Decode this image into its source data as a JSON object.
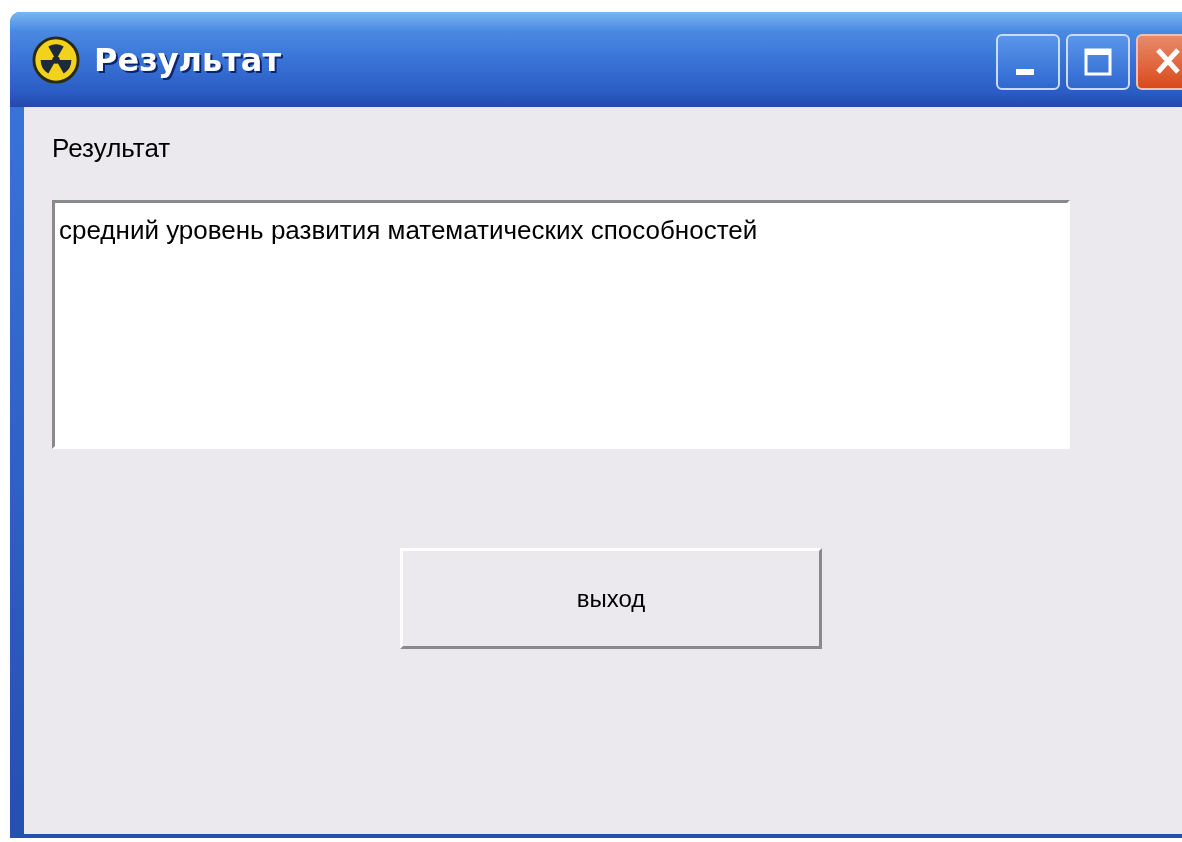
{
  "window": {
    "title": "Результат",
    "controls": [
      {
        "kind": "minimize"
      },
      {
        "kind": "maximize"
      },
      {
        "kind": "close"
      }
    ]
  },
  "label": "Результат",
  "result_field": {
    "value": "средний уровень развития математических способностей"
  },
  "buttons": [
    "выход"
  ]
}
